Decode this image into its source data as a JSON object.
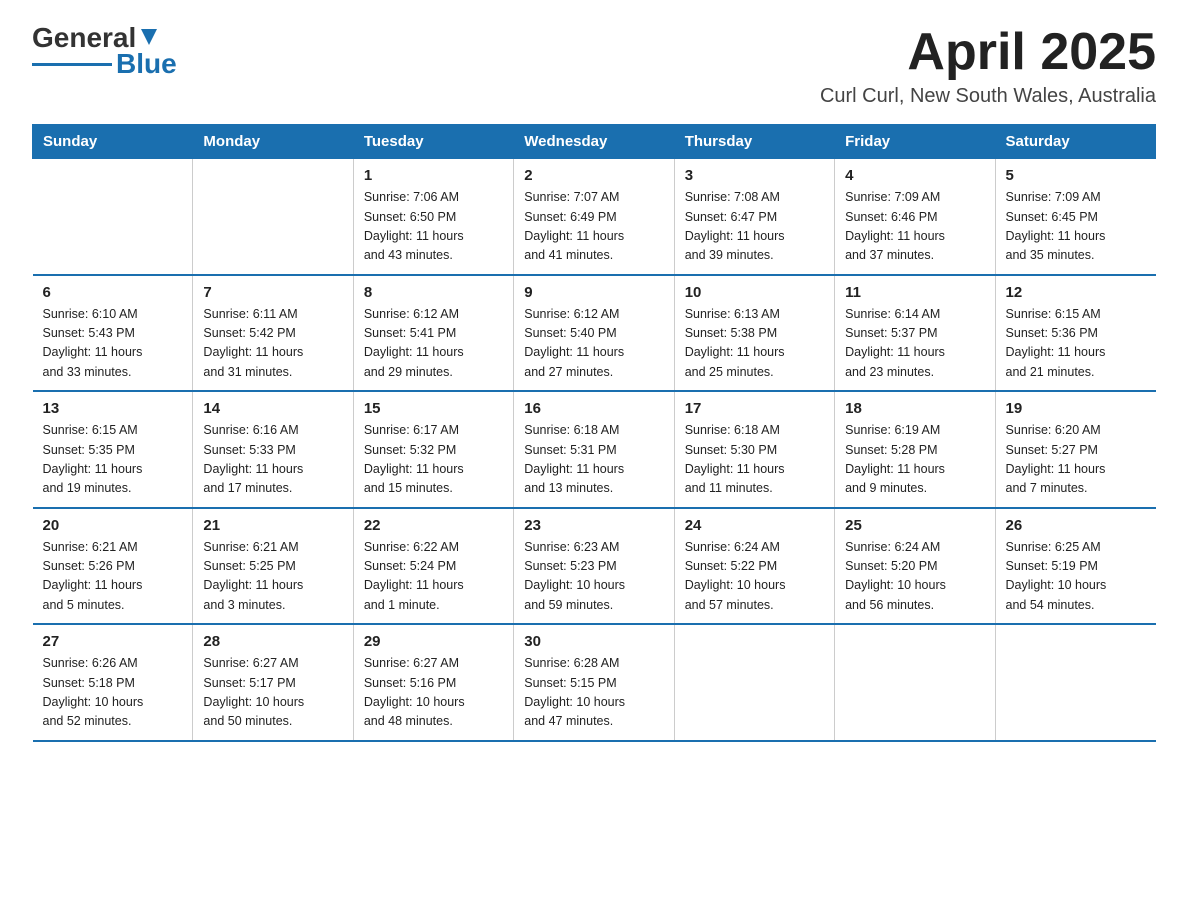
{
  "header": {
    "logo_general": "General",
    "logo_blue": "Blue",
    "month_title": "April 2025",
    "location": "Curl Curl, New South Wales, Australia"
  },
  "days_of_week": [
    "Sunday",
    "Monday",
    "Tuesday",
    "Wednesday",
    "Thursday",
    "Friday",
    "Saturday"
  ],
  "weeks": [
    [
      {
        "day": "",
        "info": ""
      },
      {
        "day": "",
        "info": ""
      },
      {
        "day": "1",
        "info": "Sunrise: 7:06 AM\nSunset: 6:50 PM\nDaylight: 11 hours\nand 43 minutes."
      },
      {
        "day": "2",
        "info": "Sunrise: 7:07 AM\nSunset: 6:49 PM\nDaylight: 11 hours\nand 41 minutes."
      },
      {
        "day": "3",
        "info": "Sunrise: 7:08 AM\nSunset: 6:47 PM\nDaylight: 11 hours\nand 39 minutes."
      },
      {
        "day": "4",
        "info": "Sunrise: 7:09 AM\nSunset: 6:46 PM\nDaylight: 11 hours\nand 37 minutes."
      },
      {
        "day": "5",
        "info": "Sunrise: 7:09 AM\nSunset: 6:45 PM\nDaylight: 11 hours\nand 35 minutes."
      }
    ],
    [
      {
        "day": "6",
        "info": "Sunrise: 6:10 AM\nSunset: 5:43 PM\nDaylight: 11 hours\nand 33 minutes."
      },
      {
        "day": "7",
        "info": "Sunrise: 6:11 AM\nSunset: 5:42 PM\nDaylight: 11 hours\nand 31 minutes."
      },
      {
        "day": "8",
        "info": "Sunrise: 6:12 AM\nSunset: 5:41 PM\nDaylight: 11 hours\nand 29 minutes."
      },
      {
        "day": "9",
        "info": "Sunrise: 6:12 AM\nSunset: 5:40 PM\nDaylight: 11 hours\nand 27 minutes."
      },
      {
        "day": "10",
        "info": "Sunrise: 6:13 AM\nSunset: 5:38 PM\nDaylight: 11 hours\nand 25 minutes."
      },
      {
        "day": "11",
        "info": "Sunrise: 6:14 AM\nSunset: 5:37 PM\nDaylight: 11 hours\nand 23 minutes."
      },
      {
        "day": "12",
        "info": "Sunrise: 6:15 AM\nSunset: 5:36 PM\nDaylight: 11 hours\nand 21 minutes."
      }
    ],
    [
      {
        "day": "13",
        "info": "Sunrise: 6:15 AM\nSunset: 5:35 PM\nDaylight: 11 hours\nand 19 minutes."
      },
      {
        "day": "14",
        "info": "Sunrise: 6:16 AM\nSunset: 5:33 PM\nDaylight: 11 hours\nand 17 minutes."
      },
      {
        "day": "15",
        "info": "Sunrise: 6:17 AM\nSunset: 5:32 PM\nDaylight: 11 hours\nand 15 minutes."
      },
      {
        "day": "16",
        "info": "Sunrise: 6:18 AM\nSunset: 5:31 PM\nDaylight: 11 hours\nand 13 minutes."
      },
      {
        "day": "17",
        "info": "Sunrise: 6:18 AM\nSunset: 5:30 PM\nDaylight: 11 hours\nand 11 minutes."
      },
      {
        "day": "18",
        "info": "Sunrise: 6:19 AM\nSunset: 5:28 PM\nDaylight: 11 hours\nand 9 minutes."
      },
      {
        "day": "19",
        "info": "Sunrise: 6:20 AM\nSunset: 5:27 PM\nDaylight: 11 hours\nand 7 minutes."
      }
    ],
    [
      {
        "day": "20",
        "info": "Sunrise: 6:21 AM\nSunset: 5:26 PM\nDaylight: 11 hours\nand 5 minutes."
      },
      {
        "day": "21",
        "info": "Sunrise: 6:21 AM\nSunset: 5:25 PM\nDaylight: 11 hours\nand 3 minutes."
      },
      {
        "day": "22",
        "info": "Sunrise: 6:22 AM\nSunset: 5:24 PM\nDaylight: 11 hours\nand 1 minute."
      },
      {
        "day": "23",
        "info": "Sunrise: 6:23 AM\nSunset: 5:23 PM\nDaylight: 10 hours\nand 59 minutes."
      },
      {
        "day": "24",
        "info": "Sunrise: 6:24 AM\nSunset: 5:22 PM\nDaylight: 10 hours\nand 57 minutes."
      },
      {
        "day": "25",
        "info": "Sunrise: 6:24 AM\nSunset: 5:20 PM\nDaylight: 10 hours\nand 56 minutes."
      },
      {
        "day": "26",
        "info": "Sunrise: 6:25 AM\nSunset: 5:19 PM\nDaylight: 10 hours\nand 54 minutes."
      }
    ],
    [
      {
        "day": "27",
        "info": "Sunrise: 6:26 AM\nSunset: 5:18 PM\nDaylight: 10 hours\nand 52 minutes."
      },
      {
        "day": "28",
        "info": "Sunrise: 6:27 AM\nSunset: 5:17 PM\nDaylight: 10 hours\nand 50 minutes."
      },
      {
        "day": "29",
        "info": "Sunrise: 6:27 AM\nSunset: 5:16 PM\nDaylight: 10 hours\nand 48 minutes."
      },
      {
        "day": "30",
        "info": "Sunrise: 6:28 AM\nSunset: 5:15 PM\nDaylight: 10 hours\nand 47 minutes."
      },
      {
        "day": "",
        "info": ""
      },
      {
        "day": "",
        "info": ""
      },
      {
        "day": "",
        "info": ""
      }
    ]
  ]
}
